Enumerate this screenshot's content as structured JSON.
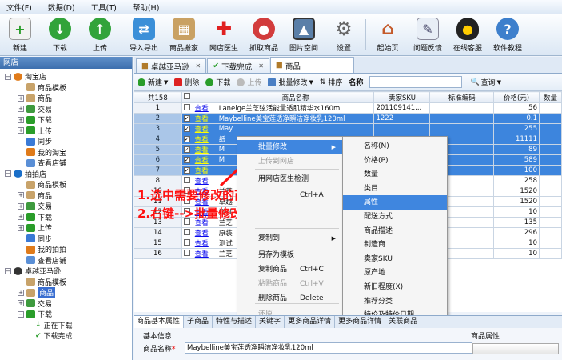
{
  "menubar": {
    "file": "文件(F)",
    "data": "数据(D)",
    "tools": "工具(T)",
    "help": "帮助(H)"
  },
  "toolbar": {
    "new": "新建",
    "download": "下载",
    "upload": "上传",
    "import_export": "导入导出",
    "mover": "商品搬家",
    "doctor": "网店医生",
    "grab": "抓取商品",
    "image_space": "图片空间",
    "settings": "设置",
    "start_page": "起始页",
    "feedback": "问题反馈",
    "support": "在线客服",
    "tutorial": "软件教程"
  },
  "left_panel": {
    "title": "网店",
    "stores": [
      {
        "name": "淘宝店",
        "items": [
          "商品模板",
          "商品",
          "交易",
          "下载",
          "上传",
          "同步",
          "我的淘宝",
          "查看店铺"
        ]
      },
      {
        "name": "拍拍店",
        "items": [
          "商品模板",
          "商品",
          "交易",
          "下载",
          "上传",
          "同步",
          "我的拍拍",
          "查看店铺"
        ]
      },
      {
        "name": "卓越亚马逊",
        "items": [
          "商品模板",
          "商品",
          "交易",
          "下载"
        ],
        "sub": [
          "正在下载",
          "下载完成"
        ]
      }
    ]
  },
  "tabs": [
    "卓越亚马逊",
    "下载完成",
    "商品"
  ],
  "subtoolbar": {
    "new": "新建",
    "delete": "删除",
    "download": "下载",
    "upload": "上传",
    "batch": "批量修改",
    "sort": "排序",
    "name_label": "名称",
    "search": "查询"
  },
  "grid": {
    "total": "共158",
    "headers": [
      "商品名称",
      "卖家SKU",
      "标准编码",
      "价格(元)",
      "数量"
    ],
    "view_label": "查看",
    "rows": [
      {
        "n": "1",
        "title": "Laneige兰芝弦活能量透肌精华水160ml",
        "sku": "201109141...",
        "price": "56"
      },
      {
        "n": "2",
        "title": "Maybelline美宝莲透净瞬洁净妆乳120ml",
        "sku": "1222",
        "price": "0.1"
      },
      {
        "n": "3",
        "title": "May",
        "sku": "",
        "price": "255"
      },
      {
        "n": "4",
        "title": "纸",
        "sku": "",
        "price": "11111"
      },
      {
        "n": "5",
        "title": "M",
        "sku": "",
        "price": "89"
      },
      {
        "n": "6",
        "title": "M",
        "sku": "",
        "price": "589"
      },
      {
        "n": "7",
        "title": "",
        "sku": "",
        "price": "100"
      },
      {
        "n": "8",
        "title": "",
        "sku": "",
        "price": "258"
      },
      {
        "n": "10",
        "title": "兰芝",
        "sku": "",
        "price": "1520"
      },
      {
        "n": "11",
        "title": "卓越",
        "sku": "",
        "price": "1520"
      },
      {
        "n": "12",
        "title": "测试",
        "sku": "",
        "price": "10"
      },
      {
        "n": "13",
        "title": "兰芝",
        "sku": "",
        "price": "135"
      },
      {
        "n": "14",
        "title": "原装",
        "sku": "",
        "price": "296"
      },
      {
        "n": "15",
        "title": "测试",
        "sku": "",
        "price": "10"
      },
      {
        "n": "16",
        "title": "兰芝",
        "sku": "",
        "price": "10"
      }
    ]
  },
  "context_menu": {
    "items": [
      {
        "label": "批量修改",
        "submenu": true,
        "hl": true
      },
      {
        "label": "上传到网店",
        "dis": true
      },
      {
        "label": "用网店医生检测"
      },
      {
        "label": "",
        "key": "Ctrl+A"
      },
      {
        "label": "复制到",
        "submenu": true
      },
      {
        "label": "另存为模板"
      },
      {
        "label": "复制商品",
        "key": "Ctrl+C"
      },
      {
        "label": "粘贴商品",
        "key": "Ctrl+V",
        "dis": true
      },
      {
        "label": "删除商品",
        "key": "Delete"
      },
      {
        "label": "还原",
        "dis": true
      }
    ]
  },
  "submenu": [
    "名称(N)",
    "价格(P)",
    "数量",
    "类目",
    "属性",
    "配送方式",
    "商品描述",
    "制造商",
    "卖家SKU",
    "原产地",
    "新旧程度(X)",
    "推荐分类",
    "特价及特价日期"
  ],
  "annotation": {
    "line1": "1.选中需要修改的商品",
    "line2": "2.右键-->批量修改"
  },
  "bottom_tabs": [
    "商品基本属性",
    "子商品",
    "特性与描述",
    "关键字",
    "更多商品详情",
    "更多商品详情",
    "关联商品"
  ],
  "props": {
    "section": "基本信息",
    "name_label": "商品名称",
    "name_value": "Maybelline美宝莲透净瞬洁净妆乳120ml",
    "attr_title": "商品属性"
  }
}
